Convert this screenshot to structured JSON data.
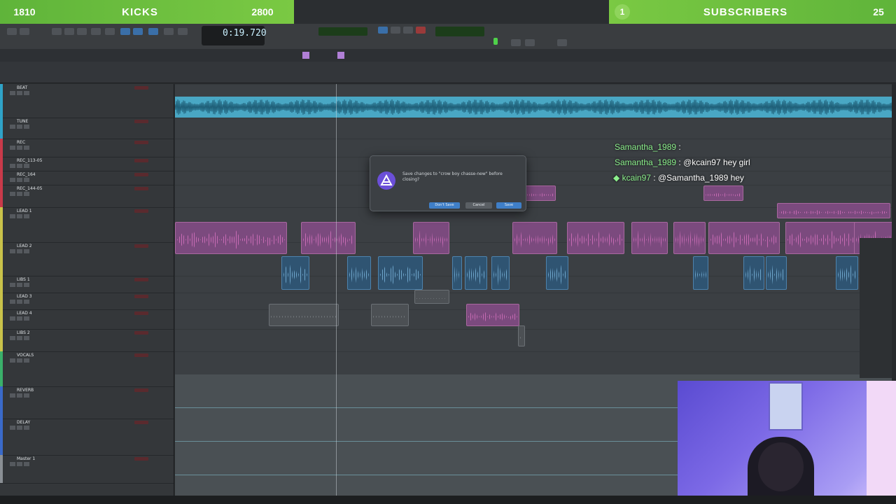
{
  "overlay": {
    "left_count": "1810",
    "left_label": "KICKS",
    "left_value": "2800",
    "right_badge": "1",
    "right_label": "SUBSCRIBERS",
    "right_value": "25"
  },
  "transport": {
    "counter": "0:19.720"
  },
  "tracks": [
    {
      "name": "BEAT",
      "color": "#2fa3c8"
    },
    {
      "name": "TUNE",
      "color": "#2fa3c8"
    },
    {
      "name": "REC",
      "color": "#c93a4a"
    },
    {
      "name": "REC_113-05",
      "color": "#c93a4a"
    },
    {
      "name": "REC_164",
      "color": "#c93a4a"
    },
    {
      "name": "REC_144-05",
      "color": "#c93a4a"
    },
    {
      "name": "LEAD 1",
      "color": "#c9c24a"
    },
    {
      "name": "LEAD 2",
      "color": "#c9c24a"
    },
    {
      "name": "LIBS 1",
      "color": "#c9c24a"
    },
    {
      "name": "LEAD 3",
      "color": "#c9c24a"
    },
    {
      "name": "LEAD 4",
      "color": "#c9c24a"
    },
    {
      "name": "LIBS 2",
      "color": "#c9c24a"
    },
    {
      "name": "VOCALS",
      "color": "#3ab06a"
    },
    {
      "name": "REVERB",
      "color": "#3a6ac9"
    },
    {
      "name": "DELAY",
      "color": "#3a6ac9"
    },
    {
      "name": "Master 1",
      "color": "#8a8f94"
    }
  ],
  "dialog": {
    "message": "Save changes to \"crow boy chasse-new\" before closing?",
    "dont_save": "Don't Save",
    "cancel": "Cancel",
    "save": "Save"
  },
  "chat": [
    {
      "user": "Samantha_1989",
      "sep": ":",
      "text": ""
    },
    {
      "user": "Samantha_1989",
      "sep": ":",
      "text": "@kcain97 hey girl"
    },
    {
      "user": "kcain97",
      "sep": ":",
      "text": "@Samantha_1989 hey"
    }
  ],
  "colors": {
    "overlay_green": "#6cbe3f",
    "beat_track": "#49a7c4",
    "clip_pink": "#7b4a7e",
    "clip_blue": "#2f5472",
    "dialog_accent": "#3f7fc8"
  }
}
